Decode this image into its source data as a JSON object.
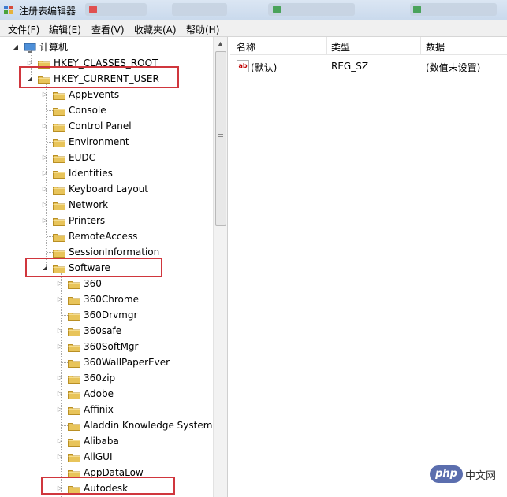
{
  "window": {
    "title": "注册表编辑器"
  },
  "menu": [
    "文件(F)",
    "编辑(E)",
    "查看(V)",
    "收藏夹(A)",
    "帮助(H)"
  ],
  "tree": {
    "root": "计算机",
    "nodes": [
      {
        "label": "HKEY_CLASSES_ROOT",
        "level": 1,
        "state": "collapsed"
      },
      {
        "label": "HKEY_CURRENT_USER",
        "level": 1,
        "state": "expanded",
        "highlighted": true
      },
      {
        "label": "AppEvents",
        "level": 2,
        "state": "collapsed"
      },
      {
        "label": "Console",
        "level": 2,
        "state": "leaf"
      },
      {
        "label": "Control Panel",
        "level": 2,
        "state": "collapsed"
      },
      {
        "label": "Environment",
        "level": 2,
        "state": "leaf"
      },
      {
        "label": "EUDC",
        "level": 2,
        "state": "collapsed"
      },
      {
        "label": "Identities",
        "level": 2,
        "state": "collapsed"
      },
      {
        "label": "Keyboard Layout",
        "level": 2,
        "state": "collapsed"
      },
      {
        "label": "Network",
        "level": 2,
        "state": "collapsed"
      },
      {
        "label": "Printers",
        "level": 2,
        "state": "collapsed"
      },
      {
        "label": "RemoteAccess",
        "level": 2,
        "state": "leaf"
      },
      {
        "label": "SessionInformation",
        "level": 2,
        "state": "leaf"
      },
      {
        "label": "Software",
        "level": 2,
        "state": "expanded",
        "highlighted": true
      },
      {
        "label": "360",
        "level": 3,
        "state": "collapsed"
      },
      {
        "label": "360Chrome",
        "level": 3,
        "state": "collapsed"
      },
      {
        "label": "360Drvmgr",
        "level": 3,
        "state": "leaf"
      },
      {
        "label": "360safe",
        "level": 3,
        "state": "collapsed"
      },
      {
        "label": "360SoftMgr",
        "level": 3,
        "state": "collapsed"
      },
      {
        "label": "360WallPaperEver",
        "level": 3,
        "state": "leaf"
      },
      {
        "label": "360zip",
        "level": 3,
        "state": "collapsed"
      },
      {
        "label": "Adobe",
        "level": 3,
        "state": "collapsed"
      },
      {
        "label": "Affinix",
        "level": 3,
        "state": "collapsed"
      },
      {
        "label": "Aladdin Knowledge Systems",
        "level": 3,
        "state": "leaf"
      },
      {
        "label": "Alibaba",
        "level": 3,
        "state": "collapsed"
      },
      {
        "label": "AliGUI",
        "level": 3,
        "state": "collapsed"
      },
      {
        "label": "AppDataLow",
        "level": 3,
        "state": "leaf"
      },
      {
        "label": "Autodesk",
        "level": 3,
        "state": "collapsed",
        "highlighted": true
      }
    ]
  },
  "list": {
    "columns": [
      "名称",
      "类型",
      "数据"
    ],
    "rows": [
      {
        "name": "(默认)",
        "type": "REG_SZ",
        "data": "(数值未设置)",
        "icon": "string-value-icon"
      }
    ]
  },
  "watermark": {
    "logo": "php",
    "text": "中文网"
  },
  "colors": {
    "highlight_box": "#d0363d",
    "folder": "#e8c45a"
  }
}
